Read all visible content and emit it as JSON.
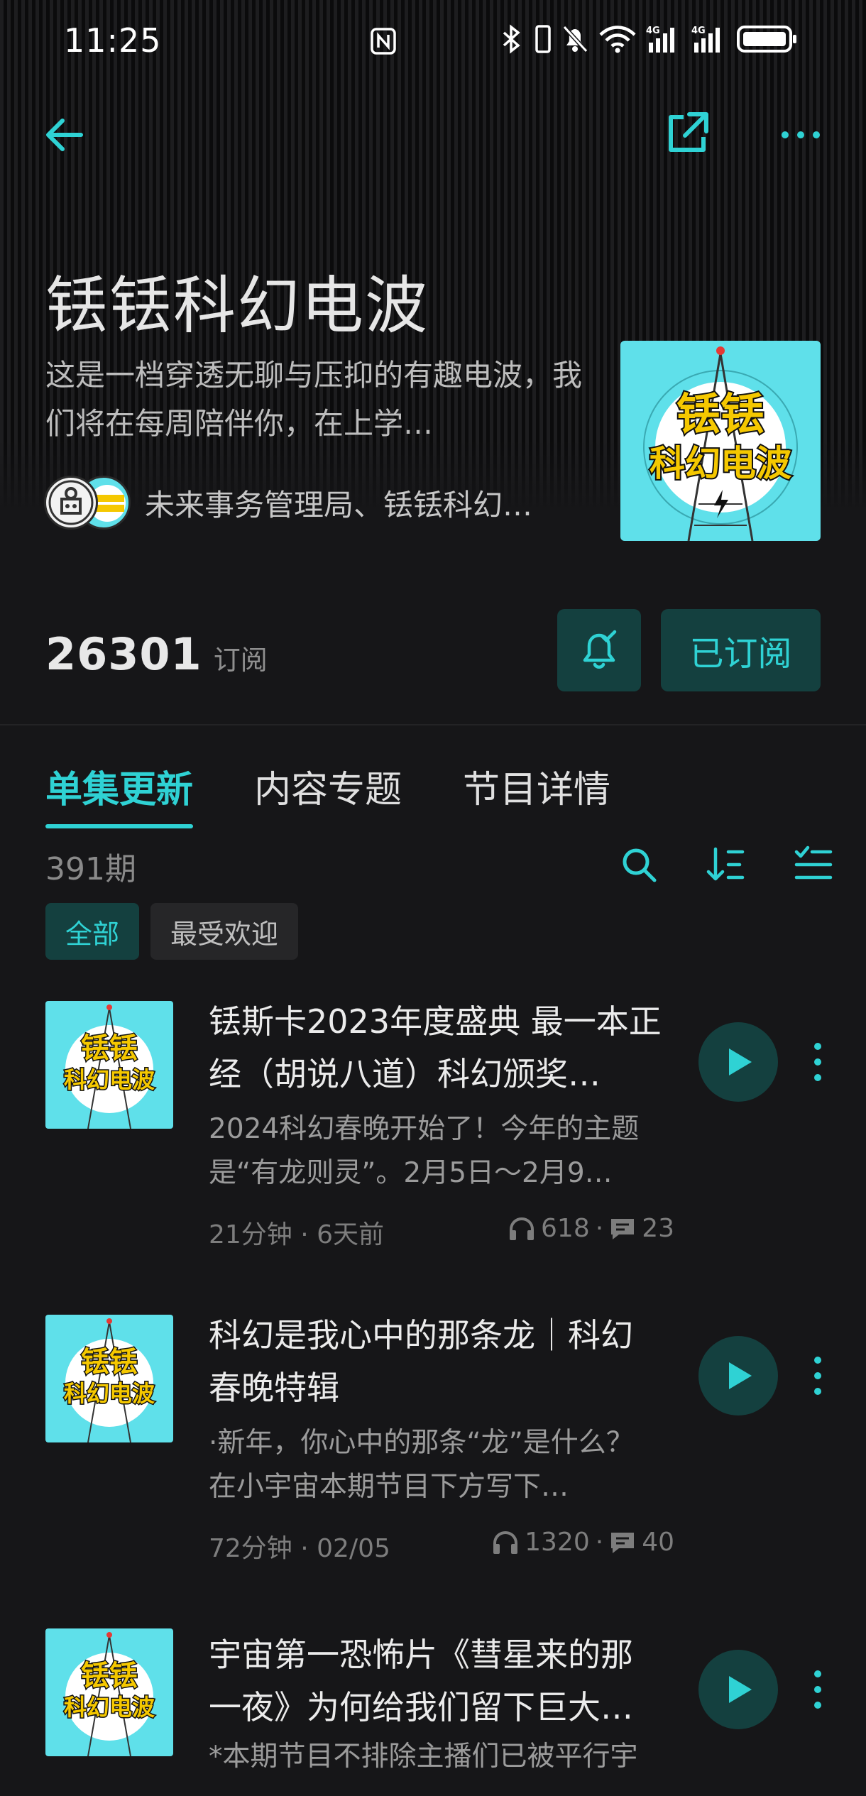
{
  "status_bar": {
    "time": "11:25",
    "network_1": "4G",
    "network_2": "4G"
  },
  "podcast": {
    "title": "铥铥科幻电波",
    "description": "这是一档穿透无聊与压抑的有趣电波，我们将在每周陪伴你，在上学…",
    "authors": "未来事务管理局、铥铥科幻…",
    "cover_text_top": "铥铥",
    "cover_text_bottom": "科幻电波",
    "subscriber_count": "26301",
    "subscriber_label": "订阅",
    "subscribed_label": "已订阅"
  },
  "tabs": [
    {
      "label": "单集更新",
      "active": true
    },
    {
      "label": "内容专题",
      "active": false
    },
    {
      "label": "节目详情",
      "active": false
    }
  ],
  "episode_total": "391期",
  "filters": [
    {
      "label": "全部",
      "active": true
    },
    {
      "label": "最受欢迎",
      "active": false
    }
  ],
  "episodes": [
    {
      "title": "铥斯卡2023年度盛典 最一本正经（胡说八道）科幻颁奖…",
      "description": "2024科幻春晚开始了！今年的主题是“有龙则灵”。2月5日～2月9…",
      "duration_date": "21分钟 · 6天前",
      "plays": "618",
      "comments": "23"
    },
    {
      "title": "科幻是我心中的那条龙｜科幻春晚特辑",
      "description": "·新年，你心中的那条“龙”是什么？ 在小宇宙本期节目下方写下…",
      "duration_date": "72分钟 · 02/05",
      "plays": "1320",
      "comments": "40"
    },
    {
      "title": "宇宙第一恐怖片《彗星来的那一夜》为何给我们留下巨大…",
      "description": "*本期节目不排除主播们已被平行宇",
      "duration_date": "",
      "plays": "",
      "comments": ""
    }
  ],
  "colors": {
    "accent": "#2fd2d4",
    "accent_bg": "#14403f",
    "background": "#161618",
    "cover_bg": "#5fe0ea",
    "cover_text": "#f5c800"
  }
}
